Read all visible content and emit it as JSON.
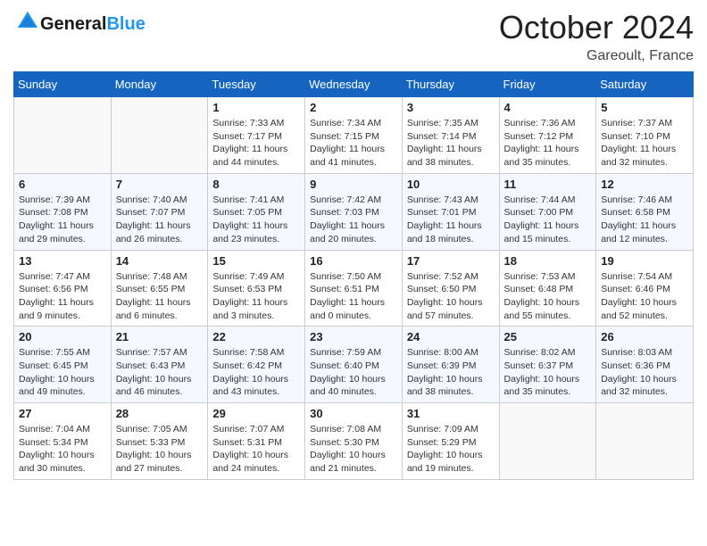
{
  "header": {
    "logo_text_general": "General",
    "logo_text_blue": "Blue",
    "month_title": "October 2024",
    "location": "Gareoult, France"
  },
  "days_of_week": [
    "Sunday",
    "Monday",
    "Tuesday",
    "Wednesday",
    "Thursday",
    "Friday",
    "Saturday"
  ],
  "weeks": [
    [
      {
        "day": "",
        "sunrise": "",
        "sunset": "",
        "daylight": ""
      },
      {
        "day": "",
        "sunrise": "",
        "sunset": "",
        "daylight": ""
      },
      {
        "day": "1",
        "sunrise": "Sunrise: 7:33 AM",
        "sunset": "Sunset: 7:17 PM",
        "daylight": "Daylight: 11 hours and 44 minutes."
      },
      {
        "day": "2",
        "sunrise": "Sunrise: 7:34 AM",
        "sunset": "Sunset: 7:15 PM",
        "daylight": "Daylight: 11 hours and 41 minutes."
      },
      {
        "day": "3",
        "sunrise": "Sunrise: 7:35 AM",
        "sunset": "Sunset: 7:14 PM",
        "daylight": "Daylight: 11 hours and 38 minutes."
      },
      {
        "day": "4",
        "sunrise": "Sunrise: 7:36 AM",
        "sunset": "Sunset: 7:12 PM",
        "daylight": "Daylight: 11 hours and 35 minutes."
      },
      {
        "day": "5",
        "sunrise": "Sunrise: 7:37 AM",
        "sunset": "Sunset: 7:10 PM",
        "daylight": "Daylight: 11 hours and 32 minutes."
      }
    ],
    [
      {
        "day": "6",
        "sunrise": "Sunrise: 7:39 AM",
        "sunset": "Sunset: 7:08 PM",
        "daylight": "Daylight: 11 hours and 29 minutes."
      },
      {
        "day": "7",
        "sunrise": "Sunrise: 7:40 AM",
        "sunset": "Sunset: 7:07 PM",
        "daylight": "Daylight: 11 hours and 26 minutes."
      },
      {
        "day": "8",
        "sunrise": "Sunrise: 7:41 AM",
        "sunset": "Sunset: 7:05 PM",
        "daylight": "Daylight: 11 hours and 23 minutes."
      },
      {
        "day": "9",
        "sunrise": "Sunrise: 7:42 AM",
        "sunset": "Sunset: 7:03 PM",
        "daylight": "Daylight: 11 hours and 20 minutes."
      },
      {
        "day": "10",
        "sunrise": "Sunrise: 7:43 AM",
        "sunset": "Sunset: 7:01 PM",
        "daylight": "Daylight: 11 hours and 18 minutes."
      },
      {
        "day": "11",
        "sunrise": "Sunrise: 7:44 AM",
        "sunset": "Sunset: 7:00 PM",
        "daylight": "Daylight: 11 hours and 15 minutes."
      },
      {
        "day": "12",
        "sunrise": "Sunrise: 7:46 AM",
        "sunset": "Sunset: 6:58 PM",
        "daylight": "Daylight: 11 hours and 12 minutes."
      }
    ],
    [
      {
        "day": "13",
        "sunrise": "Sunrise: 7:47 AM",
        "sunset": "Sunset: 6:56 PM",
        "daylight": "Daylight: 11 hours and 9 minutes."
      },
      {
        "day": "14",
        "sunrise": "Sunrise: 7:48 AM",
        "sunset": "Sunset: 6:55 PM",
        "daylight": "Daylight: 11 hours and 6 minutes."
      },
      {
        "day": "15",
        "sunrise": "Sunrise: 7:49 AM",
        "sunset": "Sunset: 6:53 PM",
        "daylight": "Daylight: 11 hours and 3 minutes."
      },
      {
        "day": "16",
        "sunrise": "Sunrise: 7:50 AM",
        "sunset": "Sunset: 6:51 PM",
        "daylight": "Daylight: 11 hours and 0 minutes."
      },
      {
        "day": "17",
        "sunrise": "Sunrise: 7:52 AM",
        "sunset": "Sunset: 6:50 PM",
        "daylight": "Daylight: 10 hours and 57 minutes."
      },
      {
        "day": "18",
        "sunrise": "Sunrise: 7:53 AM",
        "sunset": "Sunset: 6:48 PM",
        "daylight": "Daylight: 10 hours and 55 minutes."
      },
      {
        "day": "19",
        "sunrise": "Sunrise: 7:54 AM",
        "sunset": "Sunset: 6:46 PM",
        "daylight": "Daylight: 10 hours and 52 minutes."
      }
    ],
    [
      {
        "day": "20",
        "sunrise": "Sunrise: 7:55 AM",
        "sunset": "Sunset: 6:45 PM",
        "daylight": "Daylight: 10 hours and 49 minutes."
      },
      {
        "day": "21",
        "sunrise": "Sunrise: 7:57 AM",
        "sunset": "Sunset: 6:43 PM",
        "daylight": "Daylight: 10 hours and 46 minutes."
      },
      {
        "day": "22",
        "sunrise": "Sunrise: 7:58 AM",
        "sunset": "Sunset: 6:42 PM",
        "daylight": "Daylight: 10 hours and 43 minutes."
      },
      {
        "day": "23",
        "sunrise": "Sunrise: 7:59 AM",
        "sunset": "Sunset: 6:40 PM",
        "daylight": "Daylight: 10 hours and 40 minutes."
      },
      {
        "day": "24",
        "sunrise": "Sunrise: 8:00 AM",
        "sunset": "Sunset: 6:39 PM",
        "daylight": "Daylight: 10 hours and 38 minutes."
      },
      {
        "day": "25",
        "sunrise": "Sunrise: 8:02 AM",
        "sunset": "Sunset: 6:37 PM",
        "daylight": "Daylight: 10 hours and 35 minutes."
      },
      {
        "day": "26",
        "sunrise": "Sunrise: 8:03 AM",
        "sunset": "Sunset: 6:36 PM",
        "daylight": "Daylight: 10 hours and 32 minutes."
      }
    ],
    [
      {
        "day": "27",
        "sunrise": "Sunrise: 7:04 AM",
        "sunset": "Sunset: 5:34 PM",
        "daylight": "Daylight: 10 hours and 30 minutes."
      },
      {
        "day": "28",
        "sunrise": "Sunrise: 7:05 AM",
        "sunset": "Sunset: 5:33 PM",
        "daylight": "Daylight: 10 hours and 27 minutes."
      },
      {
        "day": "29",
        "sunrise": "Sunrise: 7:07 AM",
        "sunset": "Sunset: 5:31 PM",
        "daylight": "Daylight: 10 hours and 24 minutes."
      },
      {
        "day": "30",
        "sunrise": "Sunrise: 7:08 AM",
        "sunset": "Sunset: 5:30 PM",
        "daylight": "Daylight: 10 hours and 21 minutes."
      },
      {
        "day": "31",
        "sunrise": "Sunrise: 7:09 AM",
        "sunset": "Sunset: 5:29 PM",
        "daylight": "Daylight: 10 hours and 19 minutes."
      },
      {
        "day": "",
        "sunrise": "",
        "sunset": "",
        "daylight": ""
      },
      {
        "day": "",
        "sunrise": "",
        "sunset": "",
        "daylight": ""
      }
    ]
  ]
}
